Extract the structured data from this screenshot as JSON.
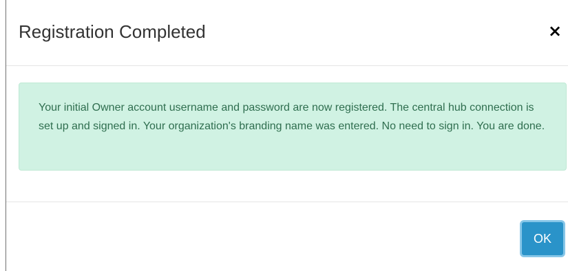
{
  "dialog": {
    "title": "Registration Completed",
    "close_label": "×",
    "close_icon": "close-icon",
    "message": "Your initial Owner account username and password are now registered. The central hub connection is set up and signed in. Your organization's branding name was entered. No need to sign in. You are done.",
    "ok_label": "OK"
  },
  "colors": {
    "alert_background": "#d0f2e3",
    "alert_text": "#2f6e4f",
    "button_primary": "#2a93c9",
    "button_focus_ring": "#86c6e8"
  }
}
